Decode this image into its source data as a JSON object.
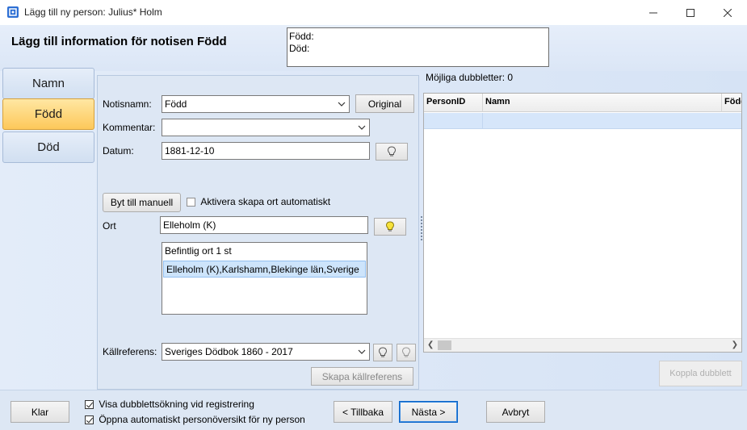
{
  "window": {
    "title": "Lägg till ny person: Julius* Holm",
    "controls": [
      "minimize",
      "maximize",
      "close"
    ]
  },
  "header": {
    "title": "Lägg till information för notisen Född",
    "summary_lines": [
      "Född:",
      "Död:"
    ]
  },
  "tabs": [
    {
      "label": "Namn",
      "active": false
    },
    {
      "label": "Född",
      "active": true
    },
    {
      "label": "Död",
      "active": false
    }
  ],
  "form": {
    "notisnamn_label": "Notisnamn:",
    "notisnamn_value": "Född",
    "original_button": "Original",
    "kommentar_label": "Kommentar:",
    "kommentar_value": "",
    "datum_label": "Datum:",
    "datum_value": "1881-12-10",
    "byt_button": "Byt till manuell",
    "aktivera_label": "Aktivera skapa ort automatiskt",
    "aktivera_checked": false,
    "ort_label": "Ort",
    "ort_value": "Elleholm (K)",
    "ort_list": [
      {
        "text": "Befintlig ort 1 st",
        "selected": false
      },
      {
        "text": "Elleholm (K),Karlshamn,Blekinge län,Sverige",
        "selected": true
      }
    ],
    "kallreferens_label": "Källreferens:",
    "kallreferens_value": "Sveriges Dödbok 1860 - 2017",
    "skapa_button": "Skapa källreferens"
  },
  "duplicates": {
    "label": "Möjliga dubbletter: 0",
    "columns": [
      "PersonID",
      "Namn",
      "Född"
    ],
    "koppla_button": "Koppla dubblett"
  },
  "footer": {
    "klar_button": "Klar",
    "visa_label": "Visa dubblettsökning vid registrering",
    "visa_checked": true,
    "oppna_label": "Öppna automatiskt personöversikt för ny person",
    "oppna_checked": true,
    "tillbaka_button": "< Tillbaka",
    "nasta_button": "Nästa >",
    "avbryt_button": "Avbryt"
  }
}
